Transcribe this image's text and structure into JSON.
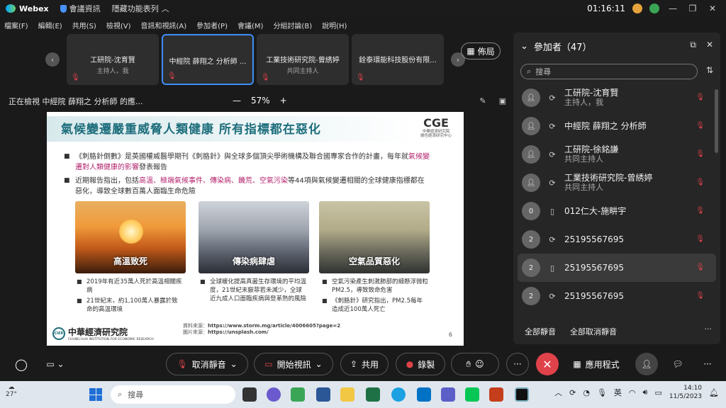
{
  "titlebar": {
    "app_name": "Webex",
    "meeting_info": "會議資訊",
    "hidden_features": "隱藏功能表列",
    "time": "01:16:11"
  },
  "menu": [
    "檔案(F)",
    "編輯(E)",
    "共用(S)",
    "檢視(V)",
    "音訊和視訊(A)",
    "參加者(P)",
    "會議(M)",
    "分組討論(B)",
    "說明(H)"
  ],
  "strip": {
    "thumbs": [
      {
        "name": "工研院-沈育賢",
        "role": "主持人，我"
      },
      {
        "name": "中經院 薛翔之 分析師 ...",
        "role": ""
      },
      {
        "name": "工業技術研究院-曾綉婷",
        "role": "共同主持人"
      },
      {
        "name": "銓泰環能科技股份有限...",
        "role": ""
      }
    ],
    "layout_label": "佈局"
  },
  "viewbar": {
    "viewing": "正在檢視 中經院 薛翔之 分析師 的應...",
    "zoom": "57%"
  },
  "slide": {
    "title": "氣候變遷嚴重威脅人類健康 所有指標都在惡化",
    "logo_abbr": "CGE",
    "logo_cn": "中華經濟研究院",
    "logo_sub": "綠色經濟研究中心",
    "bullet1_a": "《刺胳針倒數》是英國權威醫學期刊《刺胳針》與全球多個頂尖學術機構及聯合國專家合作的計畫，每年就",
    "bullet1_hl": "氣候變遷對人類健康的影響",
    "bullet1_b": "發表報告",
    "bullet2_a": "近期報告指出，包括",
    "bullet2_hl": "高溫、極端氣候事件、傳染病、饑荒、空氣污染",
    "bullet2_b": "等44項與氣候變遷相關的全球健康指標都在惡化，導致全球數百萬人面臨生命危險",
    "pics": [
      "高溫致死",
      "傳染病肆虐",
      "空氣品質惡化"
    ],
    "col1": [
      "2019年有近35萬人死於高溫相關疾病",
      "21世紀末，約1,100萬人暴露於致命的高溫環境"
    ],
    "col2": [
      "全球暖化提高真菌生存環境的平均溫度，21世紀末竅菲若未減少，全球近九成人口面臨疾病與登革熱的風險"
    ],
    "col3": [
      "空氣污染產生刺激肺部的細懸浮微粒PM2.5，導致致命危害",
      "《刺胳針》研究指出，PM2.5每年造成近100萬人死亡"
    ],
    "footer_org": "中華經濟研究院",
    "footer_org_en": "CHUNG-HUA INSTITUTION FOR ECONOMIC RESEARCH",
    "footer_logo": "CIER",
    "src1_label": "資料來源：",
    "src1_url": "https://www.storm.mg/article/4006605?page=2",
    "src2_label": "圖片來源：",
    "src2_url": "https://unsplash.com/",
    "page": "6"
  },
  "panel": {
    "title": "參加者（47）",
    "search_placeholder": "搜尋",
    "participants": [
      {
        "avatar": "",
        "name": "工研院-沈育賢",
        "role": "主持人，我"
      },
      {
        "avatar": "",
        "name": "中經院 薛翔之 分析師",
        "role": ""
      },
      {
        "avatar": "",
        "name": "工研院-徐銘謙",
        "role": "共同主持人"
      },
      {
        "avatar": "",
        "name": "工業技術研究院-曾綉婷",
        "role": "共同主持人"
      },
      {
        "avatar": "0",
        "name": "012仁大-施畊宇",
        "role": ""
      },
      {
        "avatar": "2",
        "name": "25195567695",
        "role": ""
      },
      {
        "avatar": "2",
        "name": "25195567695",
        "role": ""
      },
      {
        "avatar": "2",
        "name": "25195567695",
        "role": ""
      }
    ],
    "mute_all": "全部靜音",
    "unmute_all": "全部取消靜音"
  },
  "controls": {
    "unmute": "取消靜音",
    "start_video": "開始視訊",
    "share": "共用",
    "record": "錄製",
    "apps": "應用程式"
  },
  "taskbar": {
    "temp": "27°",
    "search": "搜尋",
    "ime": "英",
    "time": "14:10",
    "date": "11/5/2023"
  }
}
